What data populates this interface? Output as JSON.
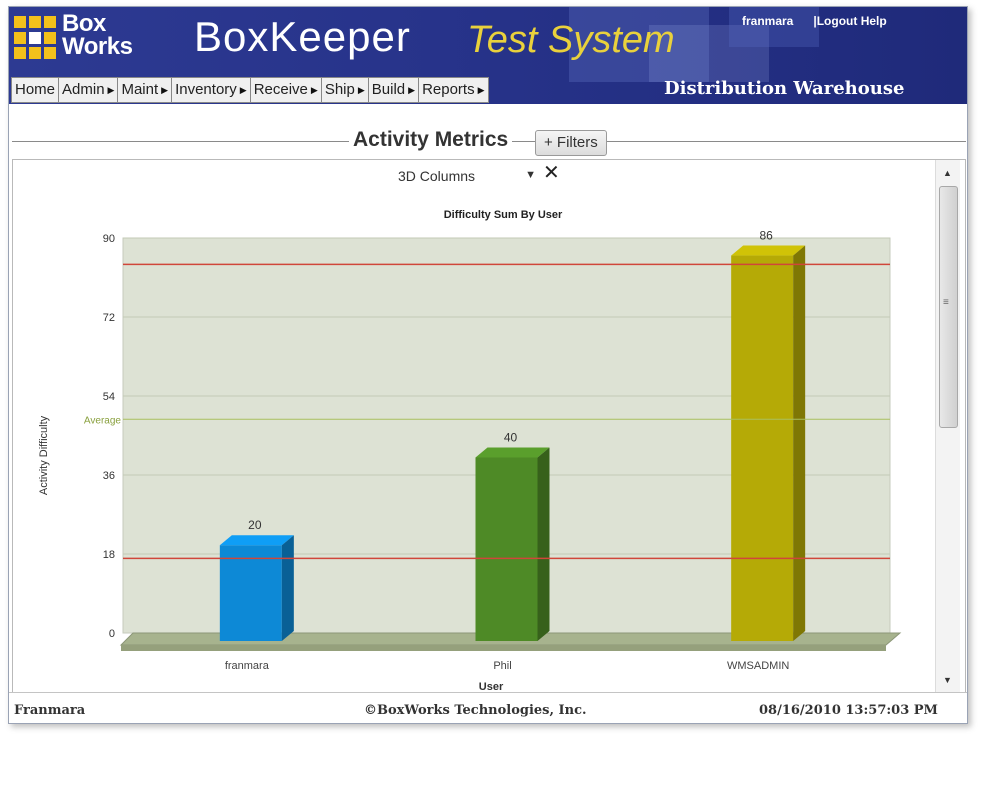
{
  "header": {
    "logo_line1": "Box",
    "logo_line2": "Works",
    "app_title": "BoxKeeper",
    "app_subtitle": "Test System",
    "user_link": "franmara",
    "logout_help": "|Logout Help",
    "warehouse": "Distribution Warehouse",
    "brand_color": "#27338a",
    "accent_color": "#e9d13c"
  },
  "nav": {
    "items": [
      {
        "label": "Home",
        "has_arrow": false
      },
      {
        "label": "Admin",
        "has_arrow": true
      },
      {
        "label": "Maint",
        "has_arrow": true
      },
      {
        "label": "Inventory",
        "has_arrow": true
      },
      {
        "label": "Receive",
        "has_arrow": true
      },
      {
        "label": "Ship",
        "has_arrow": true
      },
      {
        "label": "Build",
        "has_arrow": true
      },
      {
        "label": "Reports",
        "has_arrow": true
      }
    ]
  },
  "section": {
    "title": "Activity Metrics",
    "filters_label": "+ Filters",
    "chart_type_selected": "3D Columns",
    "close_icon": "close-icon"
  },
  "chart_data": {
    "type": "bar",
    "title": "Difficulty Sum By User",
    "xlabel": "User",
    "ylabel": "Activity Difficulty",
    "categories": [
      "franmara",
      "Phil",
      "WMSADMIN"
    ],
    "values": [
      20,
      40,
      86
    ],
    "colors": [
      "#0d89d6",
      "#4e8a26",
      "#b5aa06"
    ],
    "ylim": [
      0,
      90
    ],
    "yticks": [
      0,
      18,
      36,
      54,
      72,
      90
    ],
    "average_label": "Average",
    "average_value": 48.7,
    "reference_lines": [
      17,
      84
    ],
    "grid": true,
    "style": "3d"
  },
  "footer": {
    "user": "Franmara",
    "copyright": "©BoxWorks Technologies, Inc.",
    "timestamp": "08/16/2010 13:57:03 PM"
  }
}
